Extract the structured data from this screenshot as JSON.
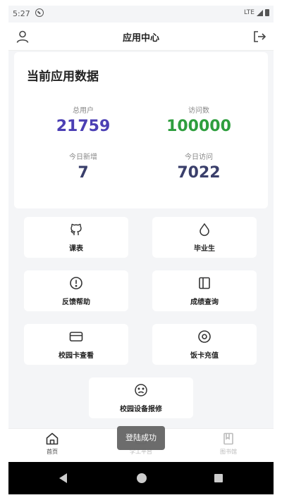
{
  "status_bar": {
    "time": "5:27",
    "network": "LTE"
  },
  "header": {
    "title": "应用中心"
  },
  "stats": {
    "title": "当前应用数据",
    "items": [
      {
        "label": "总用户",
        "value": "21759",
        "color": "#4b3fb4"
      },
      {
        "label": "访问数",
        "value": "100000",
        "color": "#2e9e3e"
      },
      {
        "label": "今日新增",
        "value": "7",
        "color": "#3a3f6b"
      },
      {
        "label": "今日访问",
        "value": "7022",
        "color": "#3a3f6b"
      }
    ]
  },
  "tiles": [
    {
      "label": "课表",
      "icon": "github-icon"
    },
    {
      "label": "毕业生",
      "icon": "droplet-icon"
    },
    {
      "label": "反馈帮助",
      "icon": "alert-circle-icon"
    },
    {
      "label": "成绩查询",
      "icon": "book-icon"
    },
    {
      "label": "校园卡查看",
      "icon": "card-icon"
    },
    {
      "label": "饭卡充值",
      "icon": "target-icon"
    },
    {
      "label": "校园设备报修",
      "icon": "sad-face-icon"
    }
  ],
  "bottom_nav": [
    {
      "label": "首页",
      "icon": "home-icon"
    },
    {
      "label": "学工平台",
      "icon": "platform-icon"
    },
    {
      "label": "图书馆",
      "icon": "library-icon"
    }
  ],
  "toast": {
    "text": "登陆成功"
  }
}
